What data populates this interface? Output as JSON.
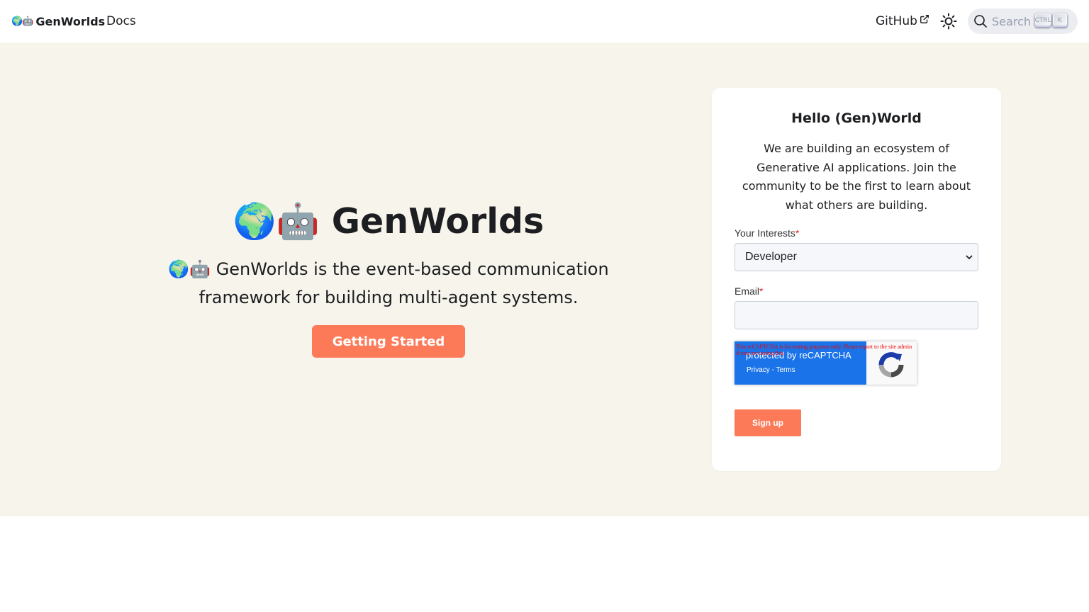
{
  "navbar": {
    "brand_emoji": "🌍🤖",
    "brand_name": "GenWorlds",
    "docs_label": "Docs",
    "github_label": "GitHub",
    "search_label": "Search",
    "kbd_ctrl": "CTRL",
    "kbd_k": "K"
  },
  "hero": {
    "title_emoji": "🌍🤖",
    "title": "GenWorlds",
    "subtitle": "🌍🤖 GenWorlds is the event-based communication framework for building multi-agent systems.",
    "cta_label": "Getting Started"
  },
  "signup_card": {
    "title": "Hello (Gen)World",
    "text": "We are building an ecosystem of Generative AI applications. Join the community to be the first to learn about what others are building.",
    "interests_label": "Your Interests",
    "interests_value": "Developer",
    "email_label": "Email",
    "required_marker": "*",
    "email_value": "",
    "recaptcha_warning": "This reCAPTCHA is for testing purposes only. Please report to the site admin if you are seeing this.",
    "recaptcha_protected": "protected by reCAPTCHA",
    "recaptcha_links": "Privacy - Terms",
    "submit_label": "Sign up"
  },
  "colors": {
    "accent": "#fd7a59",
    "hero_background": "#f7f5eb",
    "recaptcha_blue": "#1a73e8"
  }
}
